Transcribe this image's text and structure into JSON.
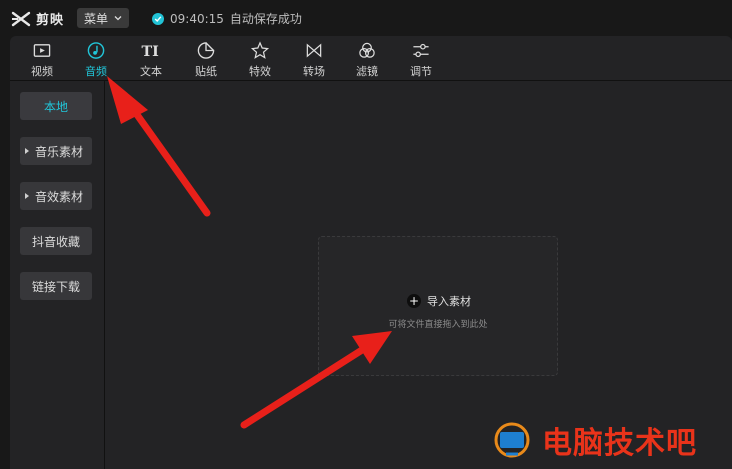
{
  "app": {
    "title": "剪映"
  },
  "menu": {
    "label": "菜单"
  },
  "status": {
    "time": "09:40:15",
    "text": "自动保存成功"
  },
  "toolbar": {
    "tabs": [
      {
        "label": "视频",
        "icon": "video-icon"
      },
      {
        "label": "音频",
        "icon": "audio-icon",
        "active": true
      },
      {
        "label": "文本",
        "icon": "text-icon"
      },
      {
        "label": "贴纸",
        "icon": "sticker-icon"
      },
      {
        "label": "特效",
        "icon": "effects-icon"
      },
      {
        "label": "转场",
        "icon": "transition-icon"
      },
      {
        "label": "滤镜",
        "icon": "filter-icon"
      },
      {
        "label": "调节",
        "icon": "adjust-icon"
      }
    ]
  },
  "sidebar": {
    "items": [
      {
        "label": "本地",
        "active": true
      },
      {
        "label": "音乐素材",
        "expandable": true
      },
      {
        "label": "音效素材",
        "expandable": true
      },
      {
        "label": "抖音收藏"
      },
      {
        "label": "链接下载"
      }
    ]
  },
  "dropzone": {
    "import_label": "导入素材",
    "hint": "可将文件直接拖入到此处"
  },
  "watermark": {
    "text": "电脑技术吧"
  },
  "colors": {
    "accent": "#21c6d9",
    "arrow": "#e8201a",
    "background": "#181818",
    "panel": "#232325"
  }
}
